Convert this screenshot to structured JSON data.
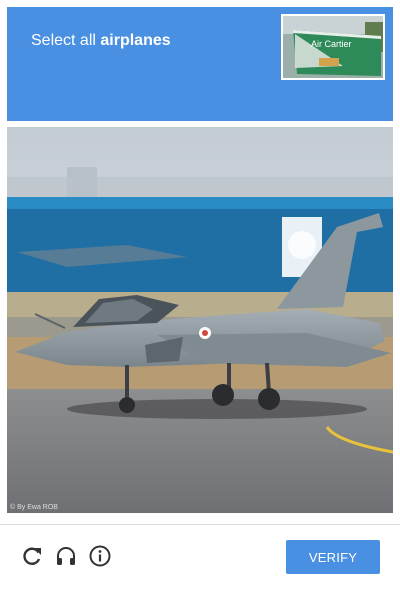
{
  "challenge": {
    "instruction_prefix": "Select all ",
    "instruction_target": "airplanes",
    "sample_image_name": "airplane-sample-thumbnail",
    "sample_sign_text": "Air Cartier",
    "main_image_name": "fighter-jet-on-runway",
    "watermark": "© By Ewa ROB"
  },
  "footer": {
    "reload_icon": "reload-icon",
    "audio_icon": "headphones-icon",
    "info_icon": "info-icon",
    "verify_label": "VERIFY"
  },
  "colors": {
    "accent": "#4a90e2",
    "header_text": "#ffffff",
    "icon": "#333333"
  }
}
